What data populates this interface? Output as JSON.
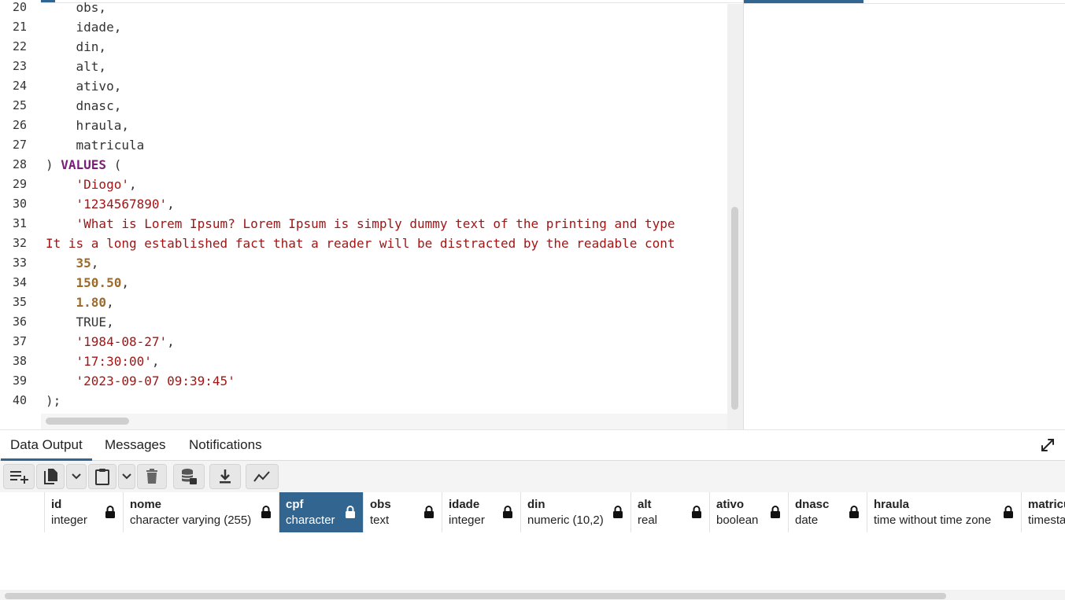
{
  "editor": {
    "lines": [
      {
        "num": "20",
        "tokens": [
          {
            "t": "plain",
            "v": "    obs,"
          }
        ]
      },
      {
        "num": "21",
        "tokens": [
          {
            "t": "plain",
            "v": "    idade,"
          }
        ]
      },
      {
        "num": "22",
        "tokens": [
          {
            "t": "plain",
            "v": "    din,"
          }
        ]
      },
      {
        "num": "23",
        "tokens": [
          {
            "t": "plain",
            "v": "    alt,"
          }
        ]
      },
      {
        "num": "24",
        "tokens": [
          {
            "t": "plain",
            "v": "    ativo,"
          }
        ]
      },
      {
        "num": "25",
        "tokens": [
          {
            "t": "plain",
            "v": "    dnasc,"
          }
        ]
      },
      {
        "num": "26",
        "tokens": [
          {
            "t": "plain",
            "v": "    hraula,"
          }
        ]
      },
      {
        "num": "27",
        "tokens": [
          {
            "t": "plain",
            "v": "    matricula"
          }
        ]
      },
      {
        "num": "28",
        "tokens": [
          {
            "t": "plain",
            "v": ") "
          },
          {
            "t": "kw",
            "v": "VALUES"
          },
          {
            "t": "plain",
            "v": " ("
          }
        ]
      },
      {
        "num": "29",
        "tokens": [
          {
            "t": "plain",
            "v": "    "
          },
          {
            "t": "str",
            "v": "'Diogo'"
          },
          {
            "t": "plain",
            "v": ","
          }
        ]
      },
      {
        "num": "30",
        "tokens": [
          {
            "t": "plain",
            "v": "    "
          },
          {
            "t": "str",
            "v": "'1234567890'"
          },
          {
            "t": "plain",
            "v": ","
          }
        ]
      },
      {
        "num": "31",
        "tokens": [
          {
            "t": "plain",
            "v": "    "
          },
          {
            "t": "str",
            "v": "'What is Lorem Ipsum? Lorem Ipsum is simply dummy text of the printing and type"
          }
        ]
      },
      {
        "num": "32",
        "tokens": [
          {
            "t": "str",
            "v": "It is a long established fact that a reader will be distracted by the readable cont"
          }
        ]
      },
      {
        "num": "33",
        "tokens": [
          {
            "t": "plain",
            "v": "    "
          },
          {
            "t": "num",
            "v": "35"
          },
          {
            "t": "plain",
            "v": ","
          }
        ]
      },
      {
        "num": "34",
        "tokens": [
          {
            "t": "plain",
            "v": "    "
          },
          {
            "t": "num",
            "v": "150.50"
          },
          {
            "t": "plain",
            "v": ","
          }
        ]
      },
      {
        "num": "35",
        "tokens": [
          {
            "t": "plain",
            "v": "    "
          },
          {
            "t": "num",
            "v": "1.80"
          },
          {
            "t": "plain",
            "v": ","
          }
        ]
      },
      {
        "num": "36",
        "tokens": [
          {
            "t": "plain",
            "v": "    TRUE,"
          }
        ]
      },
      {
        "num": "37",
        "tokens": [
          {
            "t": "plain",
            "v": "    "
          },
          {
            "t": "str",
            "v": "'1984-08-27'"
          },
          {
            "t": "plain",
            "v": ","
          }
        ]
      },
      {
        "num": "38",
        "tokens": [
          {
            "t": "plain",
            "v": "    "
          },
          {
            "t": "str",
            "v": "'17:30:00'"
          },
          {
            "t": "plain",
            "v": ","
          }
        ]
      },
      {
        "num": "39",
        "tokens": [
          {
            "t": "plain",
            "v": "    "
          },
          {
            "t": "str",
            "v": "'2023-09-07 09:39:45'"
          }
        ]
      },
      {
        "num": "40",
        "tokens": [
          {
            "t": "plain",
            "v": ");"
          }
        ]
      }
    ]
  },
  "output_tabs": [
    {
      "label": "Data Output",
      "active": true
    },
    {
      "label": "Messages",
      "active": false
    },
    {
      "label": "Notifications",
      "active": false
    }
  ],
  "toolbar": {
    "buttons": [
      {
        "name": "add-row-button",
        "icon": "add-row-icon"
      },
      {
        "name": "copy-button",
        "icon": "copy-icon"
      },
      {
        "name": "copy-options-dropdown",
        "icon": "chevron-down-icon"
      },
      {
        "name": "paste-button",
        "icon": "paste-icon"
      },
      {
        "name": "paste-options-dropdown",
        "icon": "chevron-down-icon"
      },
      {
        "name": "delete-button",
        "icon": "trash-icon"
      },
      {
        "name": "save-data-button",
        "icon": "database-save-icon"
      },
      {
        "name": "download-button",
        "icon": "download-icon"
      },
      {
        "name": "graph-button",
        "icon": "line-chart-icon"
      }
    ]
  },
  "columns": [
    {
      "name": "id",
      "type": "integer",
      "selected": false
    },
    {
      "name": "nome",
      "type": "character varying (255)",
      "selected": false
    },
    {
      "name": "cpf",
      "type": "character",
      "selected": true
    },
    {
      "name": "obs",
      "type": "text",
      "selected": false
    },
    {
      "name": "idade",
      "type": "integer",
      "selected": false
    },
    {
      "name": "din",
      "type": "numeric (10,2)",
      "selected": false
    },
    {
      "name": "alt",
      "type": "real",
      "selected": false
    },
    {
      "name": "ativo",
      "type": "boolean",
      "selected": false
    },
    {
      "name": "dnasc",
      "type": "date",
      "selected": false
    },
    {
      "name": "hraula",
      "type": "time without time zone",
      "selected": false
    },
    {
      "name": "matricula",
      "type": "timestamp",
      "selected": false
    }
  ],
  "colors": {
    "accent": "#326690",
    "keyword": "#7a1d7a",
    "string": "#a11515",
    "number": "#9c6b2c"
  }
}
